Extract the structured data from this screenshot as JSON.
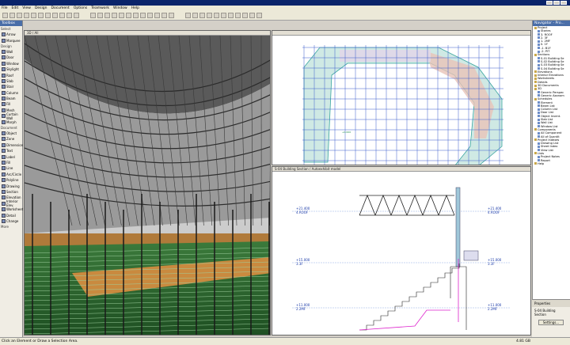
{
  "menu": [
    "File",
    "Edit",
    "View",
    "Design",
    "Document",
    "Options",
    "Teamwork",
    "Window",
    "Help"
  ],
  "toolbox": {
    "title": "Toolbox",
    "groups": [
      {
        "label": "Select",
        "tools": [
          "Arrow",
          "Marquee"
        ]
      },
      {
        "label": "Design",
        "tools": [
          "Wall",
          "Door",
          "Window",
          "Skylight",
          "Roof",
          "Slab",
          "Stair",
          "Column",
          "Beam",
          "Fill",
          "Mesh",
          "Curtain Wall",
          "Morph"
        ]
      },
      {
        "label": "Document",
        "tools": [
          "Object",
          "Zone",
          "Dimension",
          "Text",
          "Label",
          "Fill",
          "Line",
          "Arc/Circle",
          "Polyline",
          "Drawing",
          "Section",
          "Elevation",
          "Interior Elev.",
          "Worksheet",
          "Detail",
          "Change"
        ]
      },
      {
        "label": "More",
        "tools": []
      }
    ]
  },
  "pane3d": {
    "tab": "3D / All"
  },
  "panePlan": {
    "tab": ""
  },
  "paneSection": {
    "tab": "S-04 Building Section / Autoexhibit model",
    "levels": [
      {
        "value": "+21.400",
        "name": "4.ROOF"
      },
      {
        "value": "+15.000",
        "name": "3.3F"
      },
      {
        "value": "+11.000",
        "name": "2.2MF"
      }
    ],
    "levels_right": [
      {
        "value": "+21.400",
        "name": "4.ROOF"
      },
      {
        "value": "+15.000",
        "name": "3.3F"
      },
      {
        "value": "+11.000",
        "name": "2.2MF"
      }
    ]
  },
  "navigator": {
    "title": "Navigator - Pro...",
    "items": [
      "Project",
      "Stories",
      "3. ROOF",
      "2. 3F",
      "1. 2MF",
      "0. 1F",
      "-1. B1F",
      "-2. PIT",
      "Sections",
      "S-01 Building Se",
      "S-02 Building Se",
      "S-03 Building Se",
      "S-04 Building Se",
      "Elevations",
      "Interior Elevations",
      "Worksheets",
      "Details",
      "3D Documents",
      "3D",
      "Generic Perspec",
      "Generic Axonom",
      "Schedules",
      "Element",
      "Beam List",
      "Column List",
      "Door List",
      "Object Invent.",
      "Slab List",
      "Wall List",
      "Window List",
      "Components",
      "All Component",
      "All of Quantit",
      "Project Indexes",
      "Drawing List",
      "Sheet Index",
      "View List",
      "Lists",
      "Project Notes",
      "Report",
      "Help"
    ],
    "properties_label": "Properties",
    "properties_value": "S-04 Building Section",
    "settings_label": "Settings..."
  },
  "status": {
    "hint": "Click an Element or Draw a Selection Area.",
    "right": "4.81 GB"
  },
  "colors": {
    "titlebar": "#0a246a",
    "accent": "#4a6ea8",
    "level": "#1a3aa8"
  }
}
